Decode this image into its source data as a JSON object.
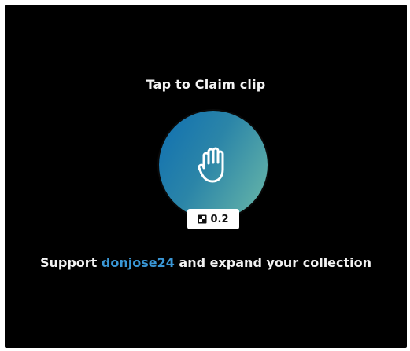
{
  "modal": {
    "title": "Tap to Claim clip",
    "price": "0.2",
    "support_prefix": "Support ",
    "username": "donjose24",
    "support_suffix": " and expand your collection"
  },
  "icons": {
    "claim": "hand-icon",
    "currency": "token-icon"
  },
  "colors": {
    "background": "#000000",
    "accent": "#3a97d6",
    "gradient_start": "#0f6fb1",
    "gradient_end": "#6bb9a8"
  }
}
